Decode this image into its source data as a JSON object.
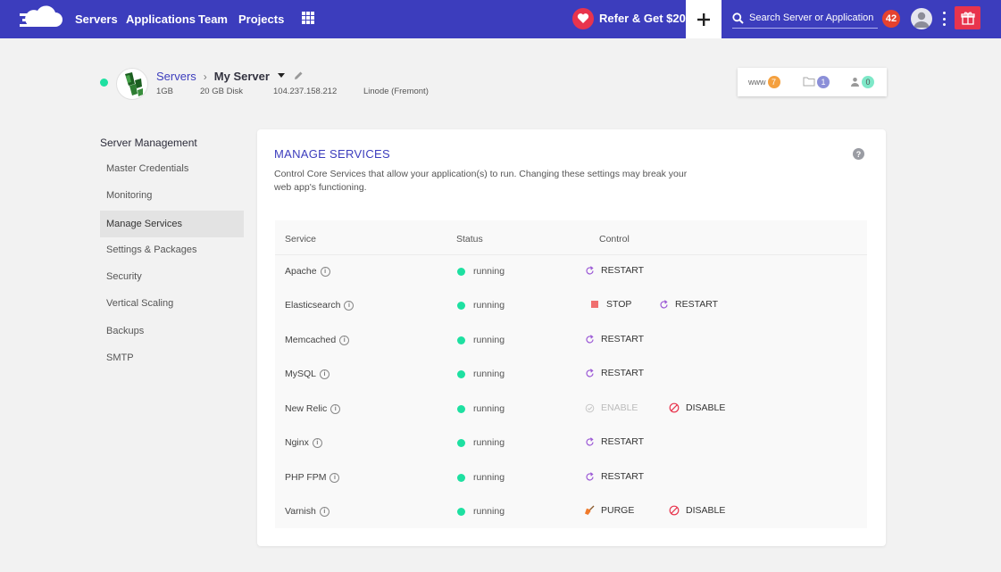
{
  "nav": {
    "links": [
      "Servers",
      "Applications",
      "Team",
      "Projects"
    ],
    "refer_label": "Refer & Get $20",
    "search_placeholder": "Search Server or Application",
    "notification_count": "42"
  },
  "server": {
    "breadcrumb_root": "Servers",
    "name": "My Server",
    "ram": "1GB",
    "disk": "20 GB Disk",
    "ip": "104.237.158.212",
    "location": "Linode (Fremont)",
    "status_color": "#1ee0a1"
  },
  "stats": {
    "www_label": "www",
    "www_count": "7",
    "files_count": "1",
    "users_count": "0"
  },
  "sidebar": {
    "title": "Server Management",
    "items": [
      "Master Credentials",
      "Monitoring",
      "Manage Services",
      "Settings & Packages",
      "Security",
      "Vertical Scaling",
      "Backups",
      "SMTP"
    ],
    "active_index": 2
  },
  "main": {
    "title": "MANAGE SERVICES",
    "description": "Control Core Services that allow your application(s) to run. Changing these settings may break your web app's functioning.",
    "headers": {
      "service": "Service",
      "status": "Status",
      "control": "Control"
    },
    "services": [
      {
        "name": "Apache",
        "status": "running",
        "controls": [
          {
            "icon": "restart-icon",
            "label": "RESTART"
          }
        ]
      },
      {
        "name": "Elasticsearch",
        "status": "running",
        "controls": [
          {
            "icon": "stop-icon",
            "label": "STOP"
          },
          {
            "icon": "restart-icon",
            "label": "RESTART"
          }
        ]
      },
      {
        "name": "Memcached",
        "status": "running",
        "controls": [
          {
            "icon": "restart-icon",
            "label": "RESTART"
          }
        ]
      },
      {
        "name": "MySQL",
        "status": "running",
        "controls": [
          {
            "icon": "restart-icon",
            "label": "RESTART"
          }
        ]
      },
      {
        "name": "New Relic",
        "status": "running",
        "controls": [
          {
            "icon": "enable-icon",
            "label": "ENABLE",
            "disabled": true
          },
          {
            "icon": "disable-icon",
            "label": "DISABLE"
          }
        ]
      },
      {
        "name": "Nginx",
        "status": "running",
        "controls": [
          {
            "icon": "restart-icon",
            "label": "RESTART"
          }
        ]
      },
      {
        "name": "PHP FPM",
        "status": "running",
        "controls": [
          {
            "icon": "restart-icon",
            "label": "RESTART"
          }
        ]
      },
      {
        "name": "Varnish",
        "status": "running",
        "controls": [
          {
            "icon": "purge-icon",
            "label": "PURGE"
          },
          {
            "icon": "disable-icon",
            "label": "DISABLE"
          }
        ]
      }
    ]
  }
}
